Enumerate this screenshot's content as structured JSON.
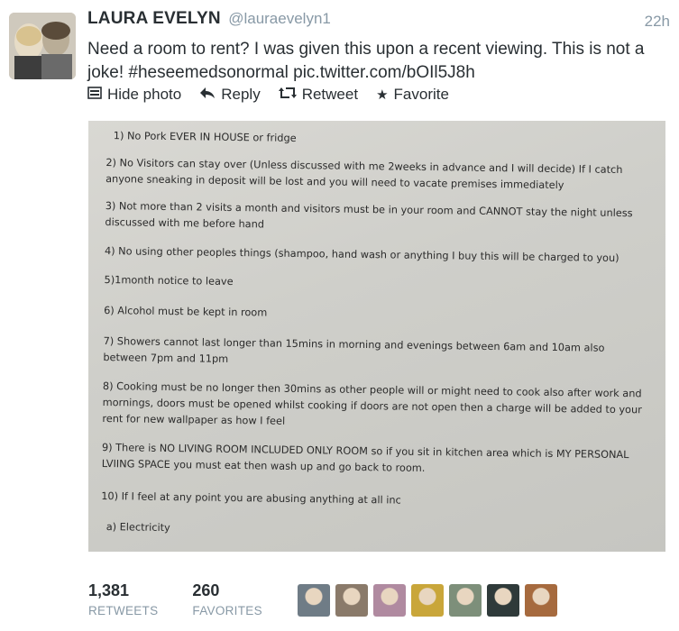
{
  "tweet": {
    "author_name": "LAURA EVELYN",
    "author_handle": "@lauraevelyn1",
    "timestamp": "22h",
    "text": "Need a room to rent? I was given this upon a recent viewing. This is not a joke! #heseemedsonormal pic.twitter.com/bOIl5J8h"
  },
  "actions": {
    "hide_photo": "Hide photo",
    "reply": "Reply",
    "retweet": "Retweet",
    "favorite": "Favorite"
  },
  "photo": {
    "rules": [
      "1) No Pork EVER IN HOUSE or fridge",
      "2) No Visitors can stay over (Unless discussed with me 2weeks in advance and I will decide) If I catch anyone sneaking in deposit will be lost and you will need to vacate premises immediately",
      "3) Not more than 2 visits a month and visitors must be in your room and CANNOT stay the night unless discussed with me before hand",
      "4) No using other peoples things (shampoo, hand wash or anything I buy this will be charged to you)",
      "5)1month notice to leave",
      "6) Alcohol must be kept in room",
      "7) Showers cannot last longer than 15mins in morning and evenings between 6am and 10am also between 7pm and 11pm",
      "8) Cooking must be no longer then 30mins as other people will or might need to cook also after work and mornings, doors must be opened whilst cooking if doors are not open then a charge will be added to your rent for new wallpaper as how I feel",
      "9) There is NO LIVING ROOM INCLUDED ONLY ROOM so if you sit in kitchen area which is MY PERSONAL LVIING SPACE you must eat then wash up and go back to room.",
      "10) If I feel at any point you are abusing anything at all inc",
      "a) Electricity"
    ]
  },
  "stats": {
    "retweets_count": "1,381",
    "retweets_label": "RETWEETS",
    "favorites_count": "260",
    "favorites_label": "FAVORITES"
  },
  "favoriters": [
    {
      "name": "favoriter-avatar-1",
      "color": "#6f7c86"
    },
    {
      "name": "favoriter-avatar-2",
      "color": "#8a7a6a"
    },
    {
      "name": "favoriter-avatar-3",
      "color": "#b08aa0"
    },
    {
      "name": "favoriter-avatar-4",
      "color": "#c9a63a"
    },
    {
      "name": "favoriter-avatar-5",
      "color": "#7d8f7a"
    },
    {
      "name": "favoriter-avatar-6",
      "color": "#2f3a3a"
    },
    {
      "name": "favoriter-avatar-7",
      "color": "#a66a3e"
    }
  ],
  "icons": {
    "hide_photo": "photo-icon",
    "reply": "reply-arrow-icon",
    "retweet": "retweet-icon",
    "favorite": "star-icon"
  }
}
